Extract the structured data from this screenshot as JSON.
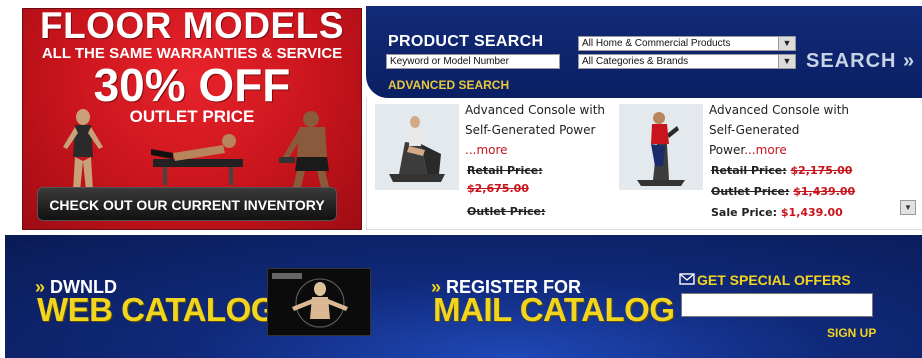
{
  "floor_banner": {
    "line1": "FLOOR MODELS",
    "line2": "ALL THE SAME WARRANTIES & SERVICE",
    "line3": "30% OFF",
    "line4": "OUTLET PRICE",
    "cta": "CHECK OUT OUR CURRENT INVENTORY"
  },
  "search": {
    "title": "PRODUCT SEARCH",
    "keyword_value": "Keyword or Model Number",
    "select1": "All Home & Commercial Products",
    "select2": "All Categories & Brands",
    "button": "SEARCH »",
    "advanced": "ADVANCED SEARCH"
  },
  "products": [
    {
      "desc_line1": "Advanced Console with",
      "desc_line2": "Self-Generated Power",
      "more": "...more",
      "retail_label": "Retail Price:",
      "retail_value": "$2,675.00",
      "outlet_label": "Outlet Price:"
    },
    {
      "desc_line1": "Advanced Console with",
      "desc_line2": "Self-Generated",
      "desc_line3": "Power",
      "more": "...more",
      "retail_label": "Retail Price:",
      "retail_value": "$2,175.00",
      "outlet_label": "Outlet Price:",
      "outlet_value": "$1,439.00",
      "sale_label": "Sale Price:",
      "sale_value": "$1,439.00"
    }
  ],
  "bottom": {
    "dwnld_small": "DWNLD",
    "dwnld_big": "WEB CATALOG",
    "raquo": "»",
    "register_small": "REGISTER FOR",
    "register_big": "MAIL CATALOG",
    "offers": "GET SPECIAL OFFERS",
    "signup": "SIGN UP"
  },
  "colors": {
    "red": "#c8141c",
    "navy": "#10297a",
    "yellow": "#f2d51e"
  }
}
